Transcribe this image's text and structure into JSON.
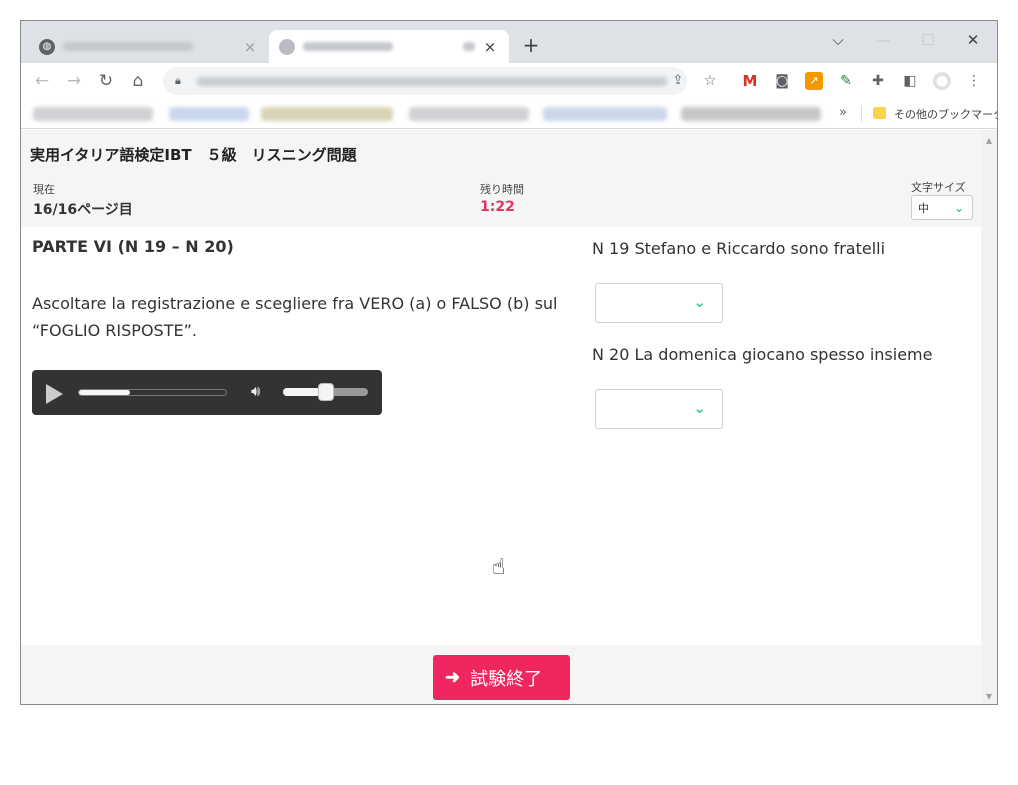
{
  "browser": {
    "tab_close_label": "×",
    "new_tab_label": "+",
    "window_controls": {
      "tablist": "⌵",
      "minimize": "—",
      "maximize": "☐",
      "close": "✕"
    },
    "nav": {
      "back": "←",
      "forward": "→",
      "reload": "↻",
      "home": "⌂"
    },
    "bookmarks_overflow": "»",
    "other_bookmarks_label": "その他のブックマーク"
  },
  "exam": {
    "title": "実用イタリア語検定IBT　５級　リスニング問題",
    "current_label": "現在",
    "current_value": "16/16ページ目",
    "time_label": "残り時間",
    "time_value": "1:22",
    "fontsize_label": "文字サイズ",
    "fontsize_value": "中"
  },
  "content": {
    "part_title": "PARTE VI (N 19 – N 20)",
    "instructions": "Ascoltare la registrazione e scegliere fra VERO (a) o FALSO (b) sul “FOGLIO RISPOSTE”.",
    "audio": {
      "progress": 0.35,
      "volume": 0.5
    },
    "questions": [
      {
        "label": "N 19 Stefano e Riccardo sono fratelli",
        "selected": ""
      },
      {
        "label": "N 20 La domenica giocano spesso insieme",
        "selected": ""
      }
    ]
  },
  "footer": {
    "finish_label": "試験終了"
  },
  "colors": {
    "accent": "#f0265f",
    "time_red": "#e8315f",
    "select_chevron": "#3cc3a5",
    "player_bg": "#333333"
  },
  "icons": {
    "exit": "sign-out-icon",
    "chevron": "chevron-down-icon",
    "play": "play-icon",
    "volume": "volume-icon"
  }
}
